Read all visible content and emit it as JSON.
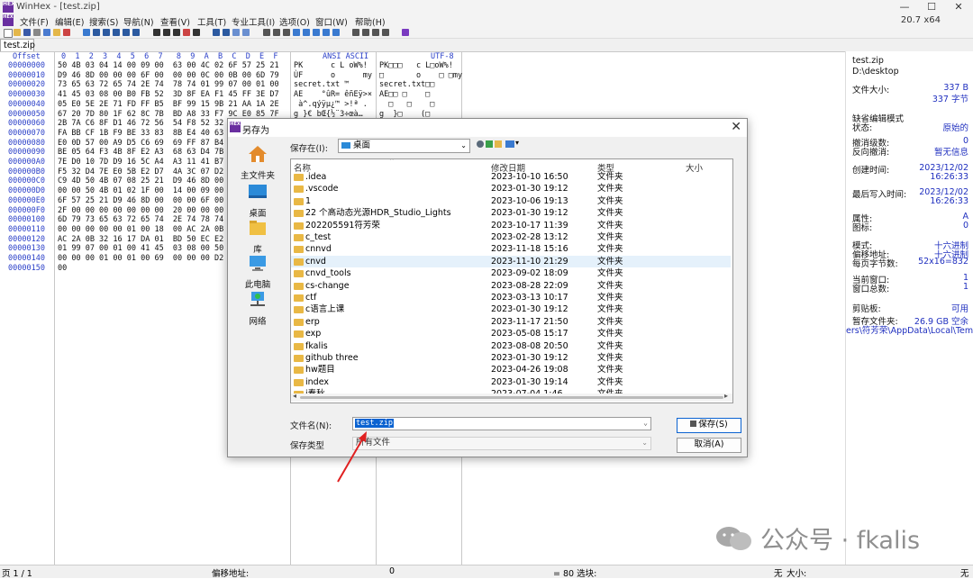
{
  "window": {
    "title": "WinHex - [test.zip]",
    "version": "20.7 x64",
    "minimize": "—",
    "maximize": "☐",
    "close": "✕"
  },
  "menu": [
    "文件(F)",
    "编辑(E)",
    "搜索(S)",
    "导航(N)",
    "查看(V)",
    "工具(T)",
    "专业工具(I)",
    "选项(O)",
    "窗口(W)",
    "帮助(H)"
  ],
  "tab": "test.zip",
  "hex_header": {
    "offset": "Offset",
    "columns": "0  1  2  3  4  5  6  7   8  9  A  B  C  D  E  F",
    "ansi": "ANSI ASCII",
    "utf": "UTF-8"
  },
  "hex_rows": [
    {
      "off": "00000000",
      "hex": "50 4B 03 04 14 00 09 00  63 00 4C 02 6F 57 25 21",
      "ansi": "PK      c L oW%!",
      "utf": "PK□□□   c L□oW%!"
    },
    {
      "off": "00000010",
      "hex": "D9 46 8D 00 00 00 6F 00  00 00 0C 00 0B 00 6D 79",
      "ansi": "ÙF      o      my",
      "utf": "□       o    □ □my"
    },
    {
      "off": "00000020",
      "hex": "73 65 63 72 65 74 2E 74  78 74 01 99 07 00 01 00",
      "ansi": "secret.txt ™",
      "utf": "secret.txt□□"
    },
    {
      "off": "00000030",
      "hex": "41 45 03 08 00 B0 FB 52  3D 8F EA F1 45 FF 3E D7",
      "ansi": "AE    °ûR= êñEÿ>×",
      "utf": "AE□□ □    □"
    },
    {
      "off": "00000040",
      "hex": "05 E0 5E 2E 71 FD FF B5  BF 99 15 9B 21 AA 1A 2E",
      "ansi": " à^.qýÿµ¿™ >!ª .",
      "utf": "  □   □    □"
    },
    {
      "off": "00000050",
      "hex": "67 20 7D 80 1F 62 8C 7B  BD A8 33 F7 9C E0 85 7F",
      "ansi": "g }€ bŒ{½¨3÷œà…",
      "utf": "g  }□    (□"
    },
    {
      "off": "00000060",
      "hex": "2B 7A C6 8F D1 46 72 56  54 F8 52 32",
      "ansi": "",
      "utf": ""
    },
    {
      "off": "00000070",
      "hex": "FA BB CF 1B F9 BE 33 83  8B E4 40 63",
      "ansi": "",
      "utf": ""
    },
    {
      "off": "00000080",
      "hex": "E0 0D 57 00 A9 D5 C6 69  69 FF 87 B4",
      "ansi": "",
      "utf": ""
    },
    {
      "off": "00000090",
      "hex": "BE 05 64 F3 4B 8F E2 A3  68 63 D4 7B",
      "ansi": "",
      "utf": ""
    },
    {
      "off": "000000A0",
      "hex": "7E D0 10 7D D9 16 5C A4  A3 11 41 B7",
      "ansi": "",
      "utf": ""
    },
    {
      "off": "000000B0",
      "hex": "F5 32 D4 7E E0 5B E2 D7  4A 3C 07 D2",
      "ansi": "",
      "utf": ""
    },
    {
      "off": "000000C0",
      "hex": "C9 4D 50 4B 07 08 25 21  D9 46 8D 00",
      "ansi": "",
      "utf": ""
    },
    {
      "off": "000000D0",
      "hex": "00 00 50 4B 01 02 1F 00  14 00 09 00",
      "ansi": "",
      "utf": ""
    },
    {
      "off": "000000E0",
      "hex": "6F 57 25 21 D9 46 8D 00  00 00 6F 00",
      "ansi": "",
      "utf": ""
    },
    {
      "off": "000000F0",
      "hex": "2F 00 00 00 00 00 00 00  20 00 00 00",
      "ansi": "",
      "utf": ""
    },
    {
      "off": "00000100",
      "hex": "6D 79 73 65 63 72 65 74  2E 74 78 74",
      "ansi": "",
      "utf": ""
    },
    {
      "off": "00000110",
      "hex": "00 00 00 00 00 01 00 18  00 AC 2A 0B 32",
      "ansi": "",
      "utf": ""
    },
    {
      "off": "00000120",
      "hex": "AC 2A 0B 32 16 17 DA 01  BD 50 EC E2",
      "ansi": "",
      "utf": ""
    },
    {
      "off": "00000130",
      "hex": "01 99 07 00 01 00 41 45  03 08 00 50",
      "ansi": "",
      "utf": ""
    },
    {
      "off": "00000140",
      "hex": "00 00 00 01 00 01 00 69  00 00 00 D2",
      "ansi": "",
      "utf": ""
    },
    {
      "off": "00000150",
      "hex": "00",
      "ansi": "",
      "utf": ""
    }
  ],
  "panel": {
    "filename": "test.zip",
    "path": "D:\\desktop",
    "rows": [
      {
        "label": "文件大小:",
        "value": "337 B"
      },
      {
        "label": "",
        "value": "337 字节"
      },
      {
        "label": "缺省编辑模式",
        "value": ""
      },
      {
        "label": "状态:",
        "value": "原始的"
      },
      {
        "label": "撤消级数:",
        "value": "0"
      },
      {
        "label": "反向撤消:",
        "value": "暂无信息"
      },
      {
        "label": "创建时间:",
        "value": "2023/12/02"
      },
      {
        "label": "",
        "value": "16:26:33"
      },
      {
        "label": "最后写入时间:",
        "value": "2023/12/02"
      },
      {
        "label": "",
        "value": "16:26:33"
      },
      {
        "label": "属性:",
        "value": "A"
      },
      {
        "label": "图标:",
        "value": "0"
      },
      {
        "label": "模式:",
        "value": "十六进制"
      },
      {
        "label": "偏移地址:",
        "value": "十六进制"
      },
      {
        "label": "每页字节数:",
        "value": "52x16=832"
      },
      {
        "label": "当前窗口:",
        "value": "1"
      },
      {
        "label": "窗口总数:",
        "value": "1"
      },
      {
        "label": "剪贴板:",
        "value": "可用"
      },
      {
        "label": "暂存文件夹:",
        "value": "26.9 GB 空余"
      }
    ],
    "temp_path": "ers\\符芳荣\\AppData\\Local\\Temp"
  },
  "status": {
    "page": "页 1 / 1",
    "offset_label": "偏移地址:",
    "offset_value": "0",
    "selection": "= 80  选块:",
    "none": "无",
    "size": "大小:",
    "none2": "无"
  },
  "dialog": {
    "title": "另存为",
    "close": "✕",
    "places": [
      "主文件夹",
      "桌面",
      "库",
      "此电脑",
      "网络"
    ],
    "save_in_label": "保存在(I):",
    "save_in_value": "桌面",
    "columns": [
      "名称",
      "修改日期",
      "类型",
      "大小"
    ],
    "files": [
      {
        "name": ".idea",
        "date": "2023-10-10 16:50",
        "type": "文件夹"
      },
      {
        "name": ".vscode",
        "date": "2023-01-30 19:12",
        "type": "文件夹"
      },
      {
        "name": "1",
        "date": "2023-10-06 19:13",
        "type": "文件夹"
      },
      {
        "name": "22 个高动态光源HDR_Studio_Lights",
        "date": "2023-01-30 19:12",
        "type": "文件夹"
      },
      {
        "name": "202205591符芳荣",
        "date": "2023-10-17 11:39",
        "type": "文件夹"
      },
      {
        "name": "c_test",
        "date": "2023-02-28 13:12",
        "type": "文件夹"
      },
      {
        "name": "cnnvd",
        "date": "2023-11-18 15:16",
        "type": "文件夹"
      },
      {
        "name": "cnvd",
        "date": "2023-11-10 21:29",
        "type": "文件夹"
      },
      {
        "name": "cnvd_tools",
        "date": "2023-09-02 18:09",
        "type": "文件夹"
      },
      {
        "name": "cs-change",
        "date": "2023-08-28 22:09",
        "type": "文件夹"
      },
      {
        "name": "ctf",
        "date": "2023-03-13 10:17",
        "type": "文件夹"
      },
      {
        "name": "c语言上课",
        "date": "2023-01-30 19:12",
        "type": "文件夹"
      },
      {
        "name": "erp",
        "date": "2023-11-17 21:50",
        "type": "文件夹"
      },
      {
        "name": "exp",
        "date": "2023-05-08 15:17",
        "type": "文件夹"
      },
      {
        "name": "fkalis",
        "date": "2023-08-08 20:50",
        "type": "文件夹"
      },
      {
        "name": "github three",
        "date": "2023-01-30 19:12",
        "type": "文件夹"
      },
      {
        "name": "hw题目",
        "date": "2023-04-26 19:08",
        "type": "文件夹"
      },
      {
        "name": "index",
        "date": "2023-01-30 19:14",
        "type": "文件夹"
      },
      {
        "name": "i春秋",
        "date": "2023-07-04 1:46",
        "type": "文件夹"
      }
    ],
    "filename_label": "文件名(N):",
    "filename_value": "test.zip",
    "filetype_label": "保存类型",
    "filetype_value": "所有文件",
    "save_button": "保存(S)",
    "cancel_button": "取消(A)"
  },
  "watermark": "公众号 · fkalis",
  "colors": {
    "accent": "#2a3fc8",
    "selection": "#0b63d1",
    "brand": "#6a2fa0"
  }
}
